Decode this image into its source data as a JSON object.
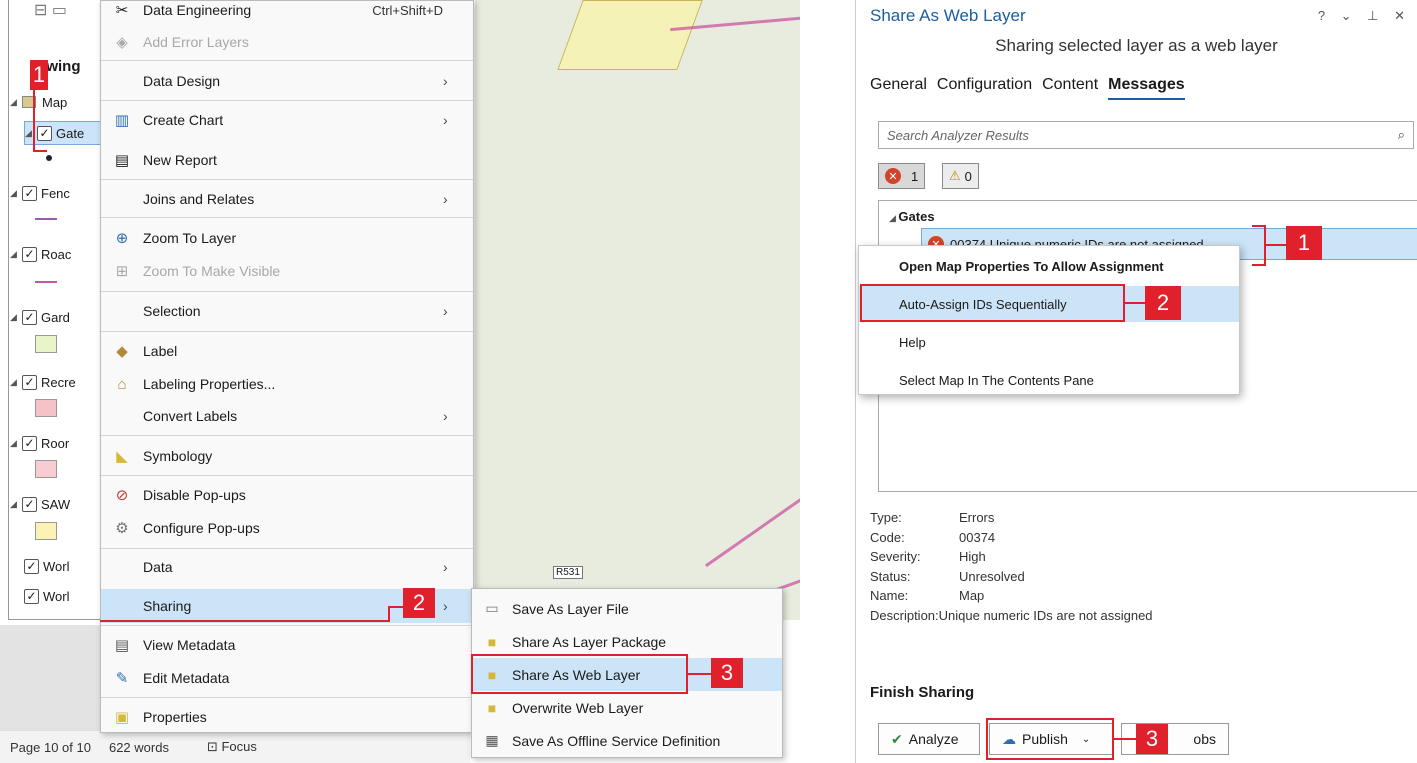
{
  "contents": {
    "title_fragment": "awing",
    "map_label": "Map",
    "layers": [
      "Gate",
      "Fenc",
      "Roac",
      "Gard",
      "Recre",
      "Roor",
      "SAW",
      "Worl",
      "Worl"
    ]
  },
  "map": {
    "road_label": "R531"
  },
  "statusbar": {
    "page": "Page 10 of 10",
    "words": "622 words",
    "focus": "Focus"
  },
  "context_menu": {
    "items": [
      {
        "label": "Data Engineering",
        "shortcut": "Ctrl+Shift+D",
        "icon": "data-engineering-icon"
      },
      {
        "label": "Add Error Layers",
        "disabled": true,
        "icon": "error-layers-icon"
      },
      {
        "label": "Data Design",
        "submenu": true
      },
      {
        "label": "Create Chart",
        "submenu": true,
        "icon": "chart-icon"
      },
      {
        "label": "New Report",
        "icon": "report-icon"
      },
      {
        "label": "Joins and Relates",
        "submenu": true
      },
      {
        "label": "Zoom To Layer",
        "icon": "zoom-icon"
      },
      {
        "label": "Zoom To Make Visible",
        "disabled": true,
        "icon": "zoom-visible-icon"
      },
      {
        "label": "Selection",
        "submenu": true
      },
      {
        "label": "Label",
        "icon": "label-icon"
      },
      {
        "label": "Labeling Properties...",
        "icon": "labeling-icon"
      },
      {
        "label": "Convert Labels",
        "submenu": true
      },
      {
        "label": "Symbology",
        "icon": "symbology-icon"
      },
      {
        "label": "Disable Pop-ups",
        "icon": "disable-popups-icon"
      },
      {
        "label": "Configure Pop-ups",
        "icon": "configure-popups-icon"
      },
      {
        "label": "Data",
        "submenu": true
      },
      {
        "label": "Sharing",
        "submenu": true,
        "highlighted": true
      },
      {
        "label": "View Metadata",
        "icon": "metadata-icon"
      },
      {
        "label": "Edit Metadata",
        "icon": "edit-icon"
      },
      {
        "label": "Properties",
        "icon": "properties-icon"
      }
    ]
  },
  "sharing_submenu": {
    "items": [
      {
        "label": "Save As Layer File"
      },
      {
        "label": "Share As Layer Package"
      },
      {
        "label": "Share As Web Layer",
        "highlighted": true
      },
      {
        "label": "Overwrite Web Layer"
      },
      {
        "label": "Save As Offline Service Definition"
      }
    ]
  },
  "callouts": {
    "one": "1",
    "two": "2",
    "three": "3"
  },
  "pane": {
    "title": "Share As Web Layer",
    "window_controls": "? ⌄ ⊥ ✕",
    "subtitle": "Sharing selected layer as a web layer",
    "tabs": [
      "General",
      "Configuration",
      "Content",
      "Messages"
    ],
    "active_tab": "Messages",
    "search_placeholder": "Search Analyzer Results",
    "error_count": "1",
    "warning_count": "0",
    "group": "Gates",
    "result_row": "00374 Unique numeric IDs are not assigned",
    "popup_items": [
      "Open Map Properties To Allow Assignment",
      "Auto-Assign IDs Sequentially",
      "Help",
      "Select Map In The Contents Pane"
    ],
    "details": [
      {
        "key": "Type:",
        "value": "Errors"
      },
      {
        "key": "Code:",
        "value": "00374"
      },
      {
        "key": "Severity:",
        "value": "High"
      },
      {
        "key": "Status:",
        "value": "Unresolved"
      },
      {
        "key": "Name:",
        "value": "Map"
      },
      {
        "key": "Description:",
        "value": "Unique numeric IDs are not assigned"
      }
    ],
    "finish_heading": "Finish Sharing",
    "analyze_label": "Analyze",
    "publish_label": "Publish",
    "jobs_label": "obs"
  },
  "colors": {
    "accent": "#1c5e9e",
    "highlight": "#cce4f7",
    "callout": "#e0202a",
    "error": "#d1432b"
  }
}
